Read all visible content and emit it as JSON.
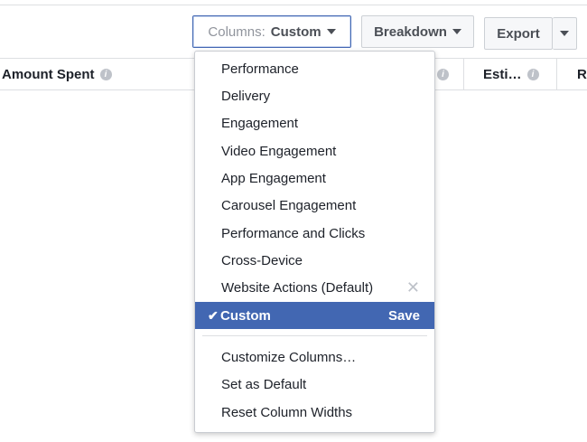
{
  "toolbar": {
    "columns_prefix": "Columns:",
    "columns_value": "Custom",
    "breakdown_label": "Breakdown",
    "export_label": "Export"
  },
  "table": {
    "headers": [
      {
        "label": "Amount Spent"
      },
      {
        "label": "Esti…"
      },
      {
        "label": "R"
      }
    ]
  },
  "columns_menu": {
    "presets": [
      "Performance",
      "Delivery",
      "Engagement",
      "Video Engagement",
      "App Engagement",
      "Carousel Engagement",
      "Performance and Clicks",
      "Cross-Device",
      "Website Actions (Default)"
    ],
    "selected": {
      "check": "✔",
      "label": "Custom",
      "save_label": "Save"
    },
    "actions": [
      "Customize Columns…",
      "Set as Default",
      "Reset Column Widths"
    ]
  },
  "colors": {
    "accent": "#4267b2",
    "border": "#dddfe2"
  }
}
